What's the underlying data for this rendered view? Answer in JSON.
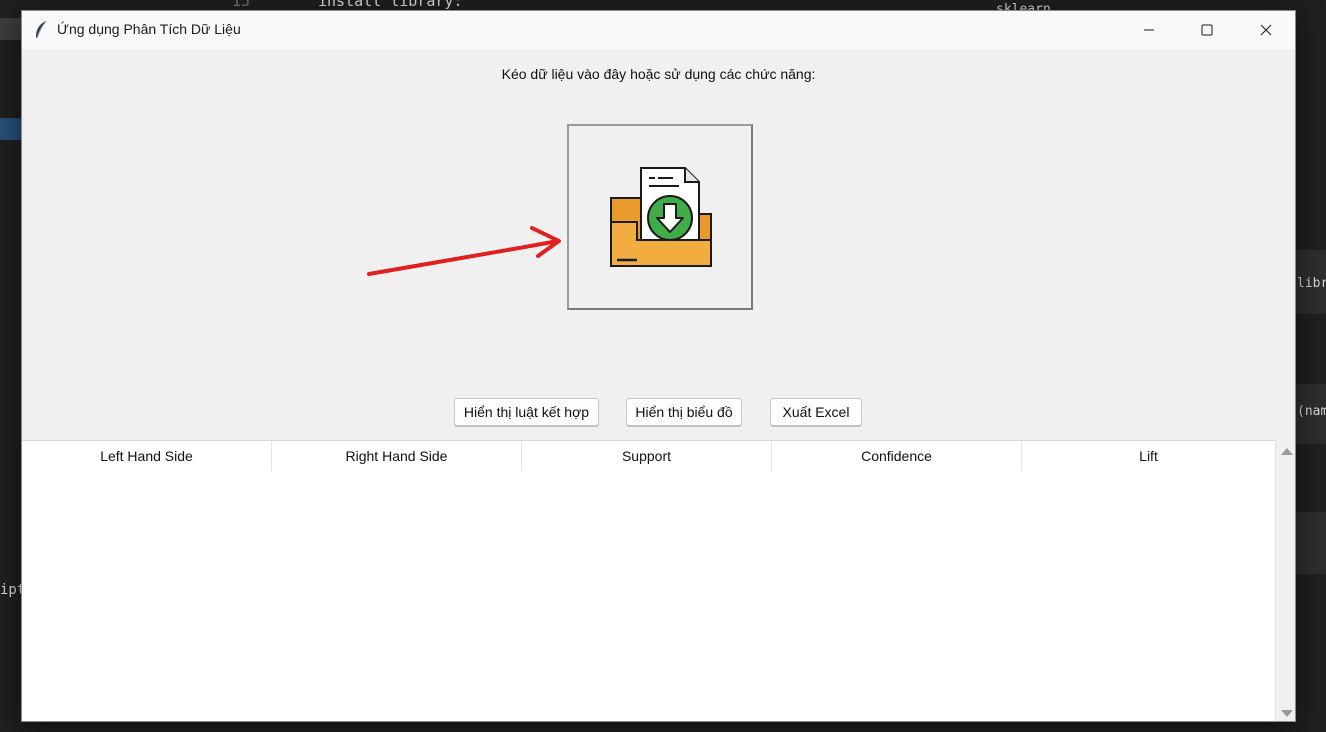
{
  "background": {
    "line_number": "15",
    "code_top": "install library:",
    "code_top_right": "sklearn",
    "right_snippet_1": "libr",
    "right_snippet_2": "(nam",
    "left_snippet": "ipt"
  },
  "window": {
    "title": "Ứng dụng Phân Tích Dữ Liệu",
    "app_icon": "feather-icon",
    "controls": [
      "minimize-icon",
      "maximize-icon",
      "close-icon"
    ]
  },
  "main": {
    "instruction": "Kéo dữ liệu vào đây hoặc sử dụng các chức năng:",
    "drop_zone_icon": "folder-download-icon",
    "annotation": "red-arrow"
  },
  "buttons": {
    "show_rules": "Hiển thị luật kết hợp",
    "show_chart": "Hiển thị biểu đồ",
    "export_excel": "Xuất Excel"
  },
  "table": {
    "columns": [
      "Left Hand Side",
      "Right Hand Side",
      "Support",
      "Confidence",
      "Lift"
    ],
    "rows": []
  },
  "colors": {
    "accent_red": "#e0201f",
    "folder_orange": "#f2ad3f",
    "download_green": "#3fae49"
  }
}
